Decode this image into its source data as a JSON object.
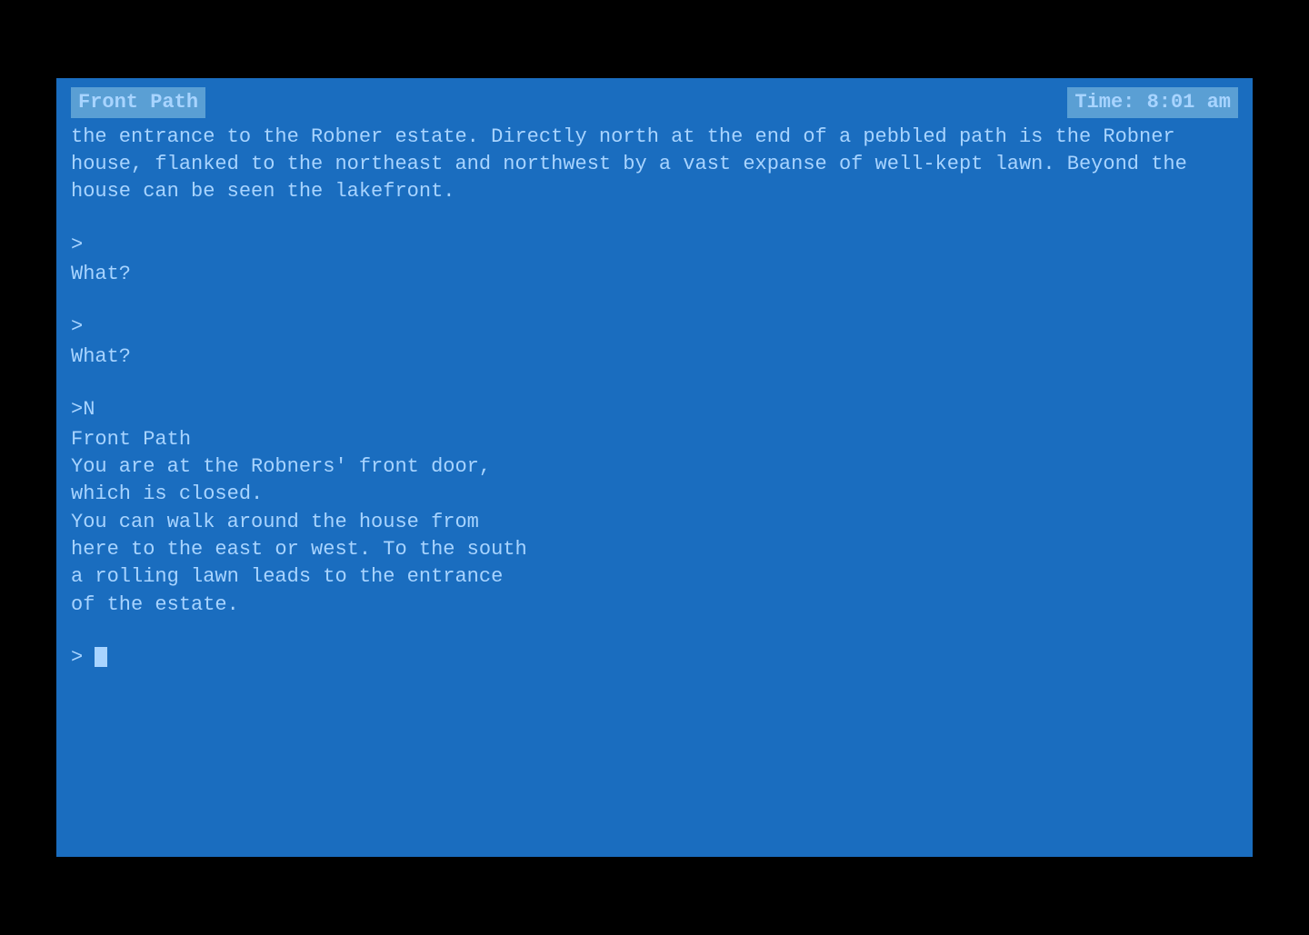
{
  "screen": {
    "background": "#1a6dbf",
    "text_color": "#a8d4ff",
    "header": {
      "location": "Front Path",
      "time_label": "Time:",
      "time_value": "8:01 am"
    },
    "content": {
      "opening_text": "the entrance to the Robner estate. Directly north at the end of a pebbled path is the Robner house, flanked to the northeast and northwest by a vast expanse of well-kept lawn. Beyond the house can be seen the lakefront.",
      "prompt1": ">",
      "response1": "What?",
      "prompt2": ">",
      "response2": "What?",
      "command": ">N",
      "location2": "Front Path",
      "desc_line1": "You are at the Robners' front door,",
      "desc_line2": "which is closed.",
      "desc_line3": "You can walk around the house from",
      "desc_line4": "here to the east or west. To the south",
      "desc_line5": "a rolling lawn leads to the entrance",
      "desc_line6": "of the estate.",
      "final_prompt": ">"
    }
  }
}
